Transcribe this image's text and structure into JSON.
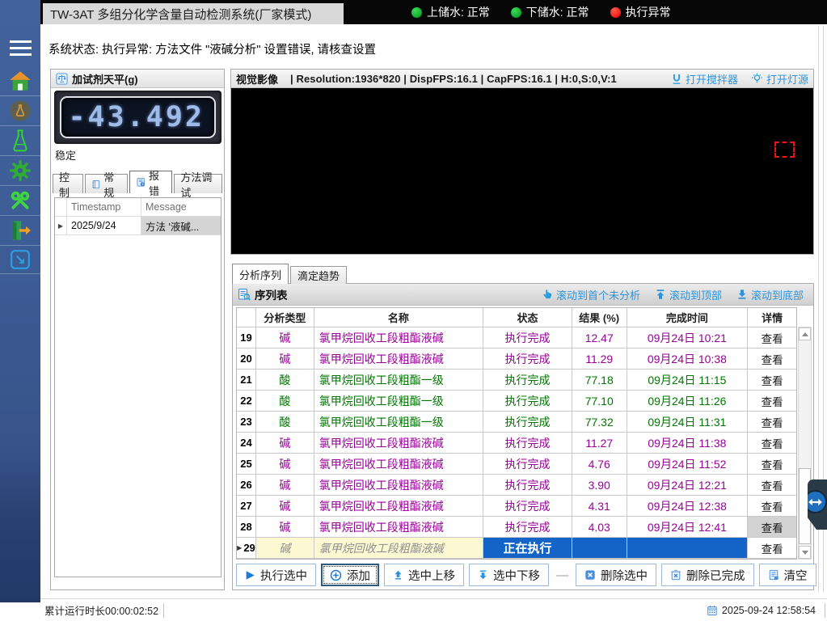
{
  "colors": {
    "sidebar_blue": "#3c5c95",
    "accent_link_blue": "#2a95dd",
    "alkali_purple": "#990099",
    "acid_green": "#007700",
    "running_row_blue": "#1464c8",
    "pending_row_cream": "#fbf8d2",
    "status_green": "#00921e",
    "status_red": "#e80000"
  },
  "titlebar": {
    "title": "TW-3AT 多组分化学含量自动检测系统(厂家模式)",
    "indicators": [
      {
        "label": "上储水: 正常",
        "state": "ok"
      },
      {
        "label": "下储水: 正常",
        "state": "ok"
      },
      {
        "label": "执行异常",
        "state": "error"
      }
    ]
  },
  "system_status": "系统状态:  执行异常: 方法文件 \"液碱分析\" 设置错误, 请核查设置",
  "balance": {
    "title": "加试剂天平(g)",
    "value": "-43.492",
    "stability": "稳定",
    "tabs": [
      {
        "label": "控制"
      },
      {
        "label": "常规"
      },
      {
        "label": "报错"
      },
      {
        "label": "方法调试"
      }
    ],
    "error_table": {
      "marker": "▶",
      "columns": {
        "timestamp": "Timestamp",
        "message": "Message"
      },
      "row": {
        "timestamp": "2025/9/24",
        "message": "方法 '液碱..."
      }
    }
  },
  "video": {
    "title": "视觉影像",
    "info": "| Resolution:1936*820 | DispFPS:16.1 | CapFPS:16.1 | H:0,S:0,V:1",
    "links": {
      "stirrer": "打开搅拌器",
      "light": "打开灯源"
    }
  },
  "sequence": {
    "tabs": [
      {
        "label": "分析序列"
      },
      {
        "label": "滴定趋势"
      }
    ],
    "toolbar": {
      "title": "序列表",
      "links": {
        "first_unanalyzed": "滚动到首个未分析",
        "to_top": "滚动到顶部",
        "to_bottom": "滚动到底部"
      }
    },
    "table": {
      "row_marker": "▶",
      "headers": [
        "",
        "分析类型",
        "名称",
        "状态",
        "结果 (%)",
        "完成时间",
        "详情"
      ],
      "detail_label": "查看",
      "rows": [
        {
          "num": "19",
          "type": "碱",
          "name": "氯甲烷回收工段粗酯液碱",
          "status": "执行完成",
          "result": "12.47",
          "time": "09月24日 10:21",
          "kind": "alkali"
        },
        {
          "num": "20",
          "type": "碱",
          "name": "氯甲烷回收工段粗酯液碱",
          "status": "执行完成",
          "result": "11.29",
          "time": "09月24日 10:38",
          "kind": "alkali"
        },
        {
          "num": "21",
          "type": "酸",
          "name": "氯甲烷回收工段粗酯一级",
          "status": "执行完成",
          "result": "77.18",
          "time": "09月24日 11:15",
          "kind": "acid"
        },
        {
          "num": "22",
          "type": "酸",
          "name": "氯甲烷回收工段粗酯一级",
          "status": "执行完成",
          "result": "77.10",
          "time": "09月24日 11:26",
          "kind": "acid"
        },
        {
          "num": "23",
          "type": "酸",
          "name": "氯甲烷回收工段粗酯一级",
          "status": "执行完成",
          "result": "77.32",
          "time": "09月24日 11:31",
          "kind": "acid"
        },
        {
          "num": "24",
          "type": "碱",
          "name": "氯甲烷回收工段粗酯液碱",
          "status": "执行完成",
          "result": "11.27",
          "time": "09月24日 11:38",
          "kind": "alkali"
        },
        {
          "num": "25",
          "type": "碱",
          "name": "氯甲烷回收工段粗酯液碱",
          "status": "执行完成",
          "result": "4.76",
          "time": "09月24日 11:52",
          "kind": "alkali"
        },
        {
          "num": "26",
          "type": "碱",
          "name": "氯甲烷回收工段粗酯液碱",
          "status": "执行完成",
          "result": "3.90",
          "time": "09月24日 12:21",
          "kind": "alkali"
        },
        {
          "num": "27",
          "type": "碱",
          "name": "氯甲烷回收工段粗酯液碱",
          "status": "执行完成",
          "result": "4.31",
          "time": "09月24日 12:38",
          "kind": "alkali"
        },
        {
          "num": "28",
          "type": "碱",
          "name": "氯甲烷回收工段粗酯液碱",
          "status": "执行完成",
          "result": "4.03",
          "time": "09月24日 12:41",
          "kind": "alkali",
          "detail_selected": true
        },
        {
          "num": "29",
          "type": "碱",
          "name": "氯甲烷回收工段粗酯液碱",
          "status": "正在执行",
          "result": "",
          "time": "",
          "kind": "alkali",
          "running": true,
          "marker": true
        }
      ]
    },
    "buttons": [
      {
        "label": "执行选中",
        "icon": "play-icon"
      },
      {
        "label": "添加",
        "icon": "add-icon",
        "focused": true
      },
      {
        "label": "选中上移",
        "icon": "move-up-icon"
      },
      {
        "label": "选中下移",
        "icon": "move-down-icon"
      },
      {
        "label": "删除选中",
        "icon": "delete-selected-icon"
      },
      {
        "label": "删除已完成",
        "icon": "delete-finished-icon"
      },
      {
        "label": "清空",
        "icon": "clear-icon"
      }
    ],
    "buttons_separator": "—"
  },
  "statusbar": {
    "runtime": "累计运行时长00:00:02:52",
    "datetime": "2025-09-24 12:58:54"
  }
}
